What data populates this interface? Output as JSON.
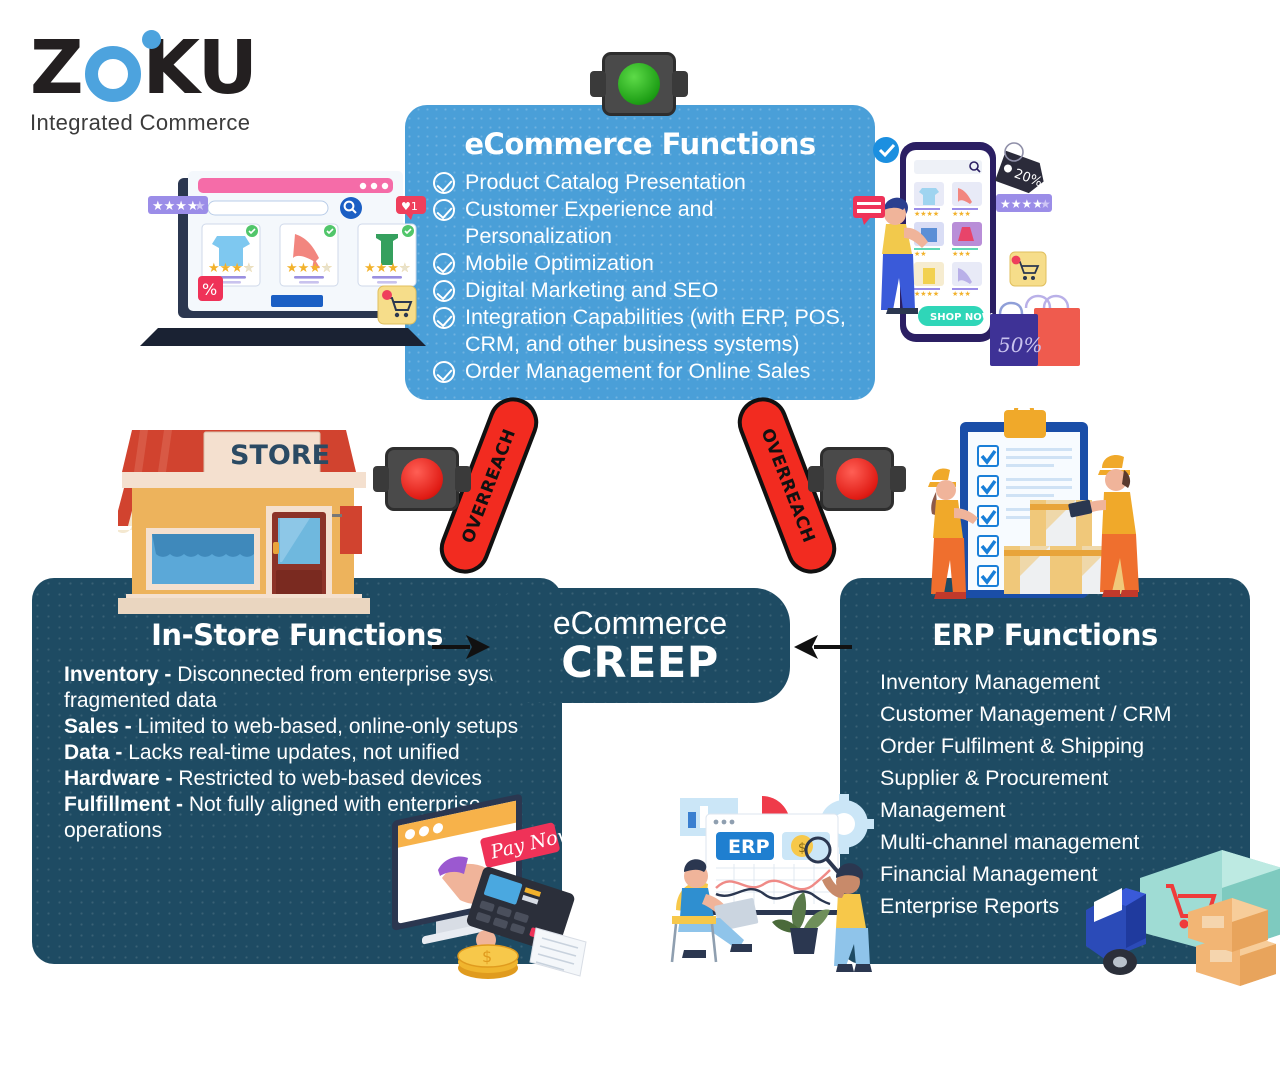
{
  "brand": {
    "name_part1": "Z",
    "name_part2": "KU",
    "tagline": "Integrated Commerce",
    "accent_color": "#4da3de",
    "text_color": "#231f20"
  },
  "colors": {
    "panel_blue": "#4a9fd8",
    "panel_navy": "#1e4b63",
    "banner_red": "#f22b20",
    "light_green": "#2eb814",
    "light_red": "#e01b14"
  },
  "ecommerce_panel": {
    "title": "eCommerce Functions",
    "items": [
      "Product Catalog Presentation",
      "Customer Experience and Personalization",
      "Mobile Optimization",
      "Digital Marketing and SEO",
      "Integration Capabilities (with ERP, POS, CRM, and other business systems)",
      "Order Management for Online Sales"
    ]
  },
  "instore_panel": {
    "title": "In-Store Functions",
    "items": [
      {
        "label": "Inventory -",
        "text": " Disconnected from enterprise system, fragmented data"
      },
      {
        "label": "Sales -",
        "text": " Limited to web-based, online-only setups"
      },
      {
        "label": "Data -",
        "text": " Lacks real-time updates, not unified"
      },
      {
        "label": "Hardware -",
        "text": " Restricted to web-based devices"
      },
      {
        "label": "Fulfillment -",
        "text": " Not fully aligned with enterprise operations"
      }
    ]
  },
  "erp_panel": {
    "title": "ERP Functions",
    "items": [
      "Inventory Management",
      "Customer Management / CRM",
      "Order Fulfilment & Shipping",
      "Supplier & Procurement Management",
      "Multi-channel management",
      "Financial Management",
      "Enterprise Reports"
    ]
  },
  "center": {
    "line1": "eCommerce",
    "line2": "CREEP"
  },
  "banners": {
    "left_label": "OVERREACH",
    "right_label": "OVERREACH"
  },
  "traffic_lights": {
    "top": "green",
    "left": "red",
    "right": "red"
  },
  "illustrations": {
    "store_sign": "STORE",
    "phone_cta": "SHOP NOW",
    "phone_discount_tag": "20%",
    "shopping_bag_discount": "50%",
    "pay_badge": "Pay Now",
    "erp_screen_label": "ERP",
    "laptop_badge_like": "1"
  }
}
